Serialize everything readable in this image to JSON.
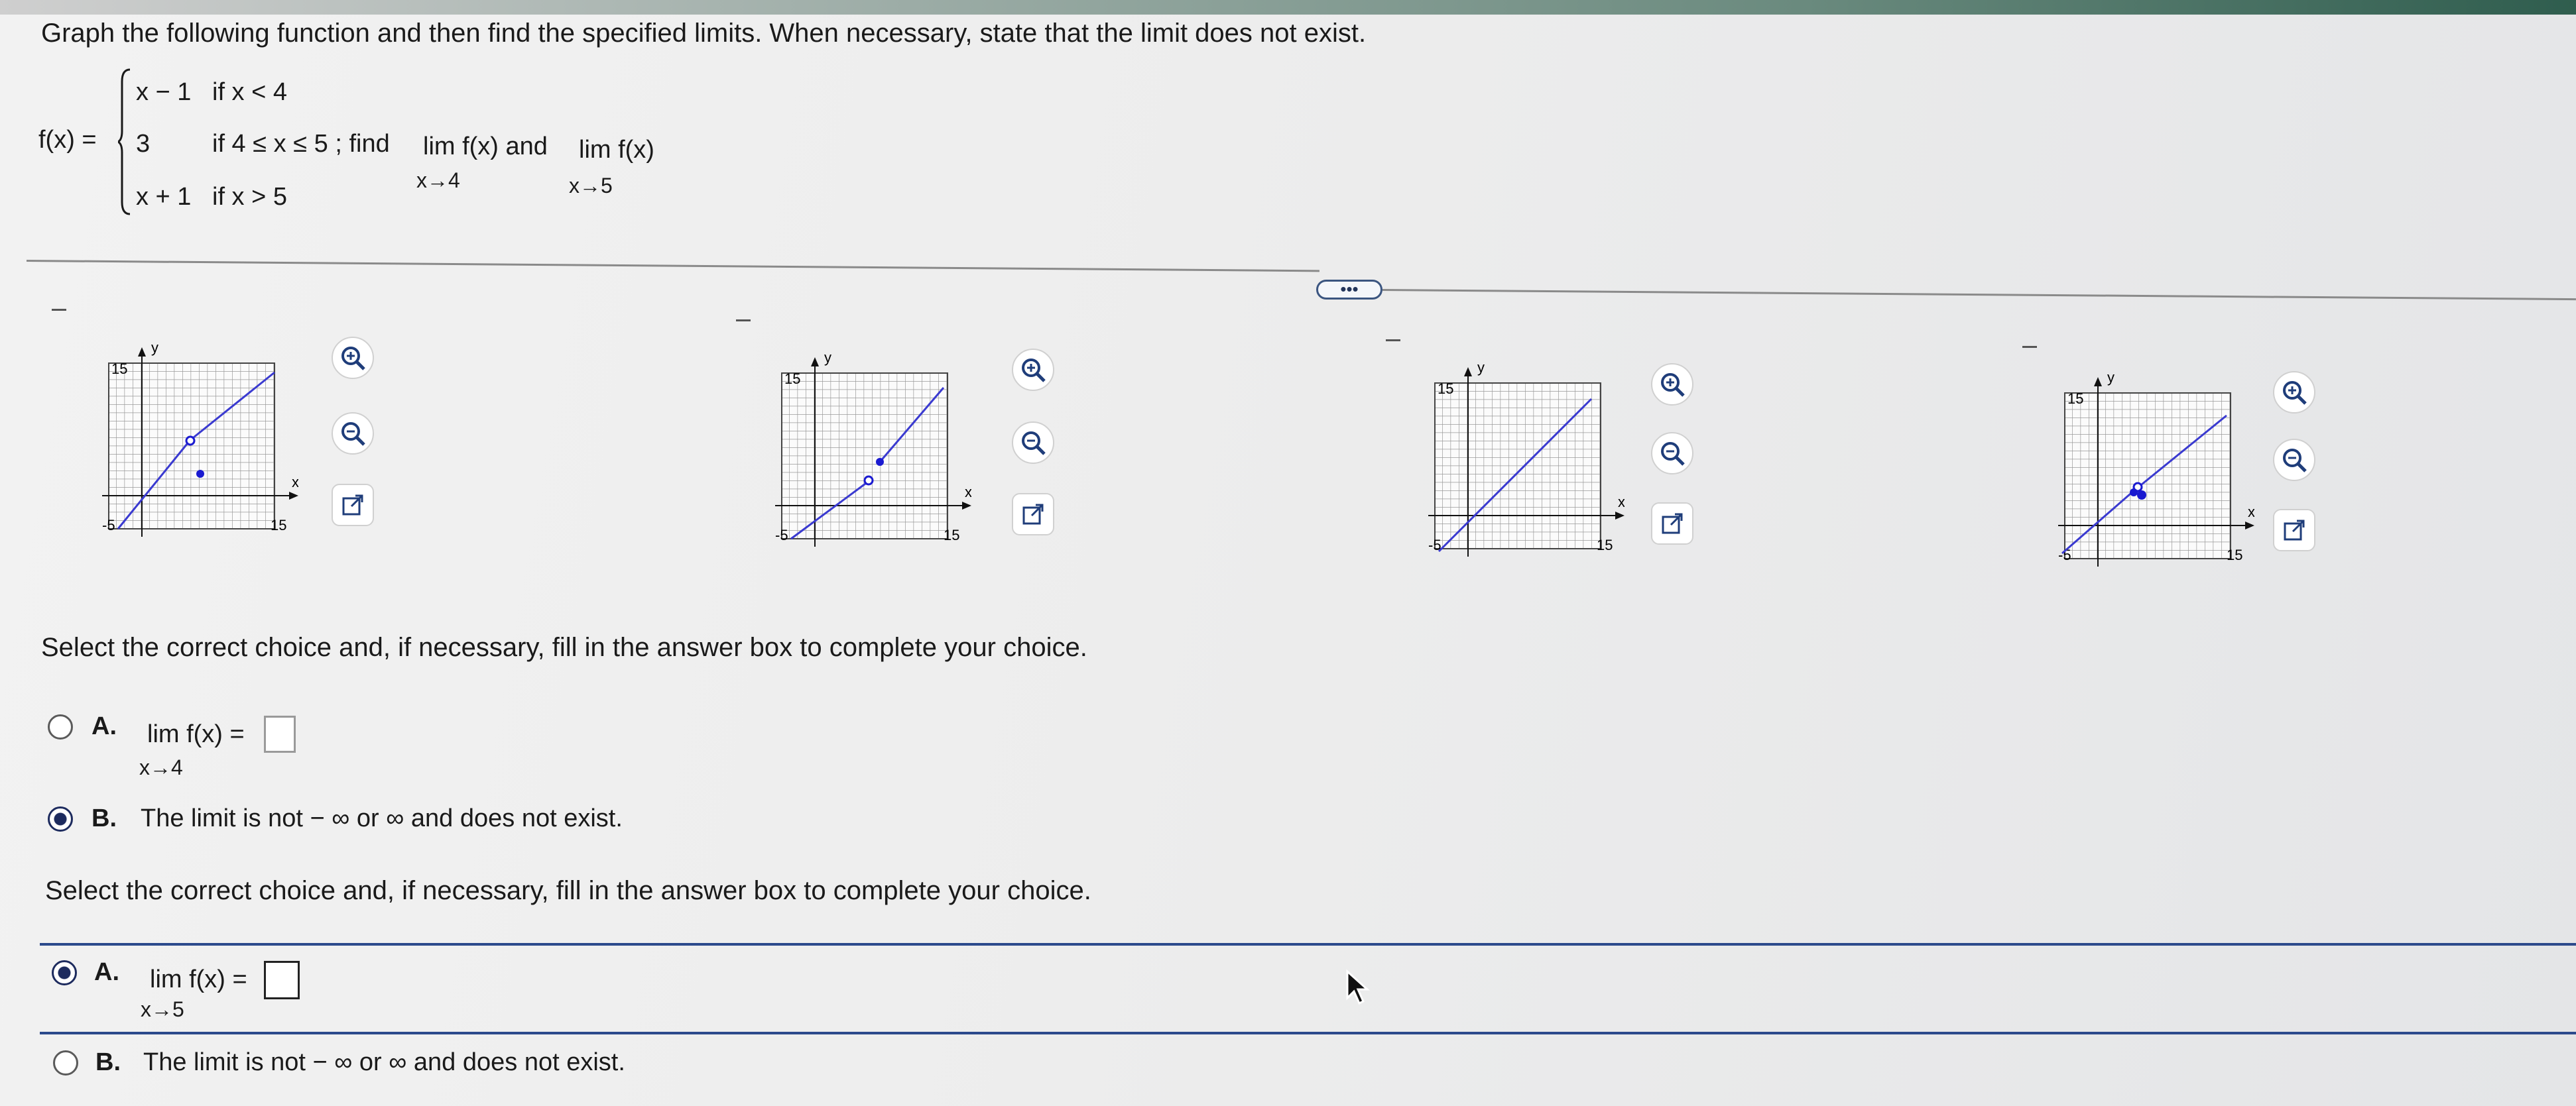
{
  "instruction": "Graph the following function and then find the specified limits. When necessary, state that the limit does not exist.",
  "function": {
    "label": "f(x) =",
    "pieces": [
      {
        "expr": "x − 1",
        "cond": "if x < 4"
      },
      {
        "expr": "3",
        "cond": "if 4 ≤ x ≤ 5 ; find"
      },
      {
        "expr": "x + 1",
        "cond": "if x > 5"
      }
    ],
    "find_text": {
      "lim1": "lim f(x) and",
      "sub1": "x→4",
      "lim2": "lim f(x)",
      "sub2": "x→5"
    }
  },
  "expand_label": "•••",
  "graphs": [
    {
      "name": "graph-a",
      "ymax_label": "15",
      "xmax_label": "15",
      "xmin_label": "-5",
      "axis_x": "x",
      "axis_y": "y"
    },
    {
      "name": "graph-b",
      "ymax_label": "15",
      "xmax_label": "15",
      "xmin_label": "-5",
      "axis_x": "x",
      "axis_y": "y"
    },
    {
      "name": "graph-c",
      "ymax_label": "15",
      "xmax_label": "15",
      "xmin_label": "-5",
      "axis_x": "x",
      "axis_y": "y"
    },
    {
      "name": "graph-d",
      "ymax_label": "15",
      "xmax_label": "15",
      "xmin_label": "-5",
      "axis_x": "x",
      "axis_y": "y"
    }
  ],
  "question1": {
    "prompt": "Select the correct choice and, if necessary, fill in the answer box to complete your choice.",
    "choice_a": {
      "letter": "A.",
      "lim": "lim f(x) =",
      "sub": "x→4",
      "selected": false
    },
    "choice_b": {
      "letter": "B.",
      "text": "The limit is not  − ∞ or ∞ and does not exist.",
      "selected": true
    }
  },
  "question2": {
    "prompt": "Select the correct choice and, if necessary, fill in the answer box to complete your choice.",
    "choice_a": {
      "letter": "A.",
      "lim": "lim f(x) =",
      "sub": "x→5",
      "selected": true
    },
    "choice_b": {
      "letter": "B.",
      "text": "The limit is not  − ∞ or ∞ and does not exist.",
      "selected": false
    }
  },
  "colors": {
    "line": "#3a3ad0",
    "point": "#1a1ad0",
    "accent": "#1d2b5e"
  },
  "icons": [
    "zoom-in-icon",
    "zoom-out-icon",
    "external-link-icon",
    "mouse-cursor-icon"
  ]
}
